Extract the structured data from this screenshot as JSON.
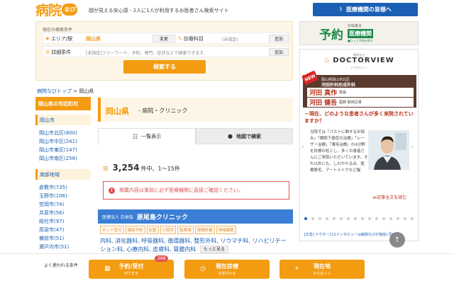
{
  "header": {
    "logo_text": "病院",
    "logo_badge": "なび",
    "tagline": "顔が見える安心感 - 2人に1人が利用するお医者さん検索サイト",
    "staff_button": "医療機関の皆様へ",
    "staff_icon": "stethoscope-icon"
  },
  "search": {
    "caption": "現在の検索条件",
    "area_label": "エリア/駅",
    "area_value": "岡山県",
    "change_label": "変更",
    "dept_label": "診療科目",
    "dept_value": "(未指定)",
    "add_label": "追加",
    "detail_label": "詳細条件",
    "detail_placeholder": "[未指定]フリーワード、予約、専門、症状などで検索できます",
    "add_label2": "追加",
    "search_button": "検索する"
  },
  "breadcrumb": {
    "top": "病院なびトップ",
    "sep": ">",
    "current": "岡山県"
  },
  "sidebar": {
    "heading": "岡山県の市区町村",
    "group1": "岡山市",
    "group1_items": [
      "岡山市北区(800)",
      "岡山市中区(241)",
      "岡山市東区(147)",
      "岡山市南区(258)"
    ],
    "group2": "南部地域",
    "group2_items": [
      "倉敷市(735)",
      "玉野市(106)",
      "笠岡市(74)",
      "井原市(56)",
      "総社市(97)",
      "高梁市(47)",
      "備前市(51)",
      "瀬戸内市(51)"
    ]
  },
  "main": {
    "pref": "岡山県",
    "title_rest": "- 病院・クリニック",
    "tab_list": "一覧表示",
    "tab_map": "地図で検索",
    "count_num": "3,254",
    "count_text": "件中、1〜15件",
    "notice": "掲載内容は事前に必ず医療機関に直接ご確認ください。",
    "clinic_corp": "医療法人 白栄会",
    "clinic_name": "原尾島クリニック",
    "tags": [
      "ネット受付",
      "電話予約",
      "女医",
      "入院可",
      "駐車場",
      "夜間診療",
      "地域連携"
    ],
    "departments": "内科, 消化器科, 呼吸器科, 循環器科, 整形外科, リウマチ科, リハビリテーション科, 心療内科, 皮膚科, 胃腸内科",
    "more_button": "もっと見る"
  },
  "ad": {
    "big": "予約",
    "sub": "が出来る",
    "main": "医療機関",
    "small": "■ウェブ予約を探す"
  },
  "doctorview": {
    "logo_small": "病院なび",
    "logo": "DOCTORVIEW",
    "logo_sub": "ドクタビュー",
    "new_badge": "NEW",
    "hospital_line1": "岡山県岡山市北区",
    "hospital_line2": "河田外科形成外科",
    "doctor1_name": "河田 真作",
    "doctor1_role": "院長",
    "doctor2_name": "河田 健吾",
    "doctor2_role": "医師 取材記事",
    "headline": "－現在、どのような患者さんが多く来院されていますか？",
    "body": "当院では「パストに関するお悩み」「眼瞼下垂症の治療」「レーザー治療」「薄毛治療」の4分野を診療の柱とし、多くの患者さんにご来院いただいています。それ以外にも、しわやたるみ、医療脱毛、アートメイクなど幅",
    "more_link": "≫記事全文を読む",
    "note": "[広告] ドクター111インタビューは病院なびが独自に取材"
  },
  "bottom_bar": {
    "label": "よく使われる条件",
    "btn1_title": "予約/受付",
    "btn1_sub": "ができる",
    "btn1_badge": "268",
    "btn2_title": "現在診療",
    "btn2_sub": "を受付ける",
    "btn3_title": "現在地",
    "btn3_sub": "から近くに"
  },
  "colors": {
    "accent": "#f39c12",
    "brand_blue": "#1a5fb4",
    "clinic_blue": "#3a7ed5",
    "alert_red": "#e05252",
    "doctorview_red": "#b8321c"
  }
}
